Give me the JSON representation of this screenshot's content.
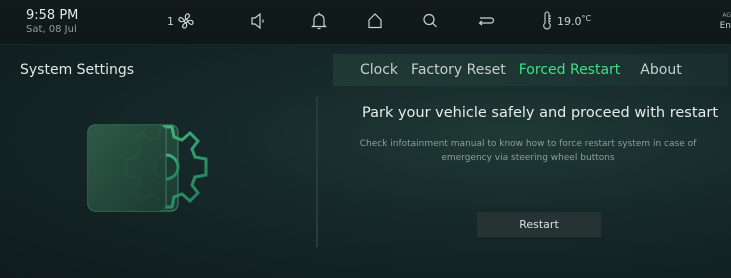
{
  "status_bar": {
    "time": "9:58 PM",
    "date": "Sat, 08 Jul",
    "fan_speed": "1",
    "temperature": "19.0",
    "temperature_unit": "°C",
    "language_short": "AG",
    "language": "En",
    "icons": [
      "fan-icon",
      "speaker-icon",
      "bell-icon",
      "home-icon",
      "search-icon",
      "back-icon",
      "thermometer-icon"
    ]
  },
  "page": {
    "title": "System Settings"
  },
  "tabs": [
    {
      "label": "Clock",
      "active": false
    },
    {
      "label": "Factory Reset",
      "active": false
    },
    {
      "label": "Forced Restart",
      "active": true
    },
    {
      "label": "About",
      "active": false
    }
  ],
  "content": {
    "heading": "Park your vehicle safely and proceed with restart",
    "description": "Check infotainment manual to know how to force restart system in case of emergency via steering wheel buttons",
    "button_label": "Restart"
  },
  "colors": {
    "accent": "#3ee08a",
    "background": "#0d1616",
    "panel": "#16292a"
  }
}
